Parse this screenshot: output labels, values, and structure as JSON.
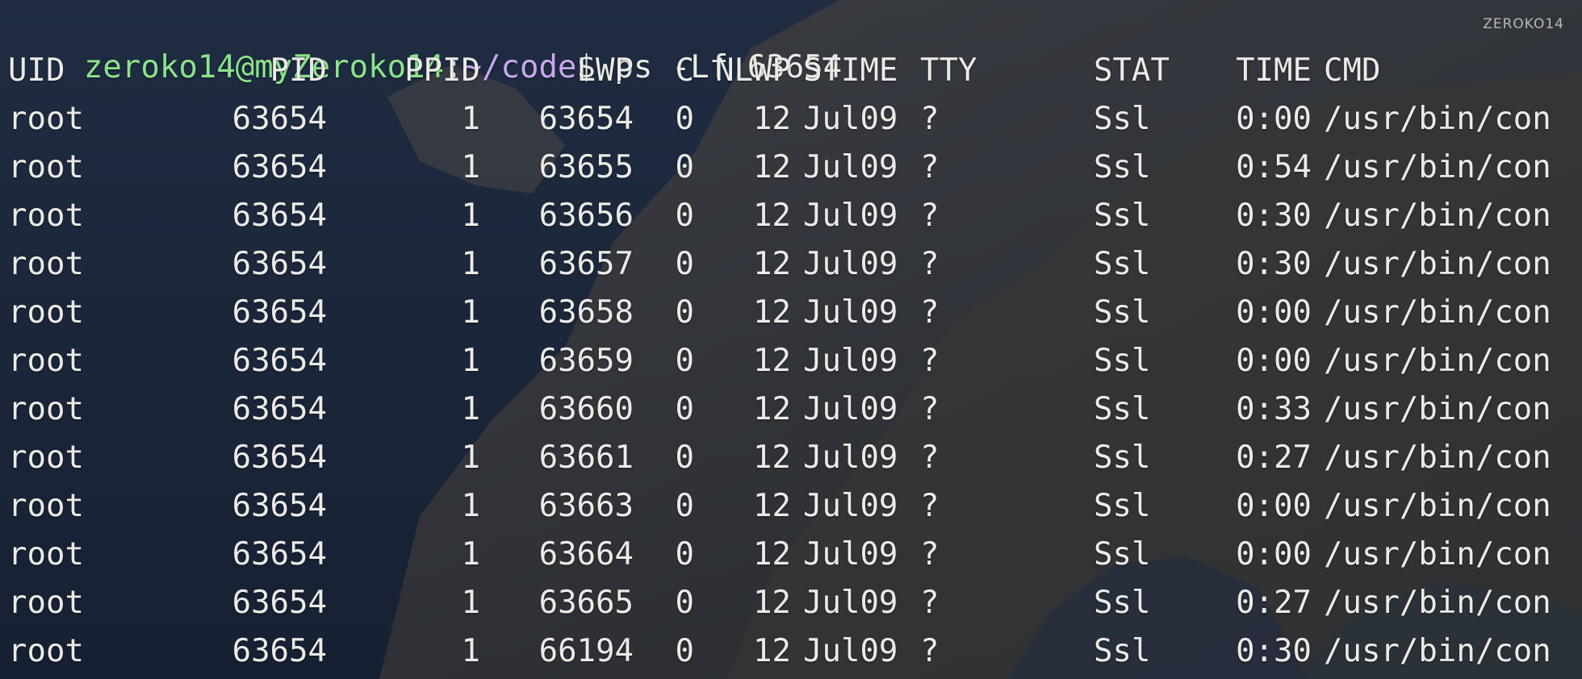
{
  "terminal": {
    "prompt": {
      "user_host": "zeroko14@myZeroko14",
      "separator": ":",
      "path": "~/code",
      "dollar": "$",
      "command": " ps -Lf 63654"
    },
    "columns": [
      "UID",
      "PID",
      "PPID",
      "LWP",
      "C",
      "NLWP",
      "STIME",
      "TTY",
      "STAT",
      "TIME",
      "CMD"
    ],
    "rows": [
      [
        "root",
        "63654",
        "1",
        "63654",
        "0",
        "12",
        "Jul09",
        "?",
        "Ssl",
        "0:00",
        "/usr/bin/con"
      ],
      [
        "root",
        "63654",
        "1",
        "63655",
        "0",
        "12",
        "Jul09",
        "?",
        "Ssl",
        "0:54",
        "/usr/bin/con"
      ],
      [
        "root",
        "63654",
        "1",
        "63656",
        "0",
        "12",
        "Jul09",
        "?",
        "Ssl",
        "0:30",
        "/usr/bin/con"
      ],
      [
        "root",
        "63654",
        "1",
        "63657",
        "0",
        "12",
        "Jul09",
        "?",
        "Ssl",
        "0:30",
        "/usr/bin/con"
      ],
      [
        "root",
        "63654",
        "1",
        "63658",
        "0",
        "12",
        "Jul09",
        "?",
        "Ssl",
        "0:00",
        "/usr/bin/con"
      ],
      [
        "root",
        "63654",
        "1",
        "63659",
        "0",
        "12",
        "Jul09",
        "?",
        "Ssl",
        "0:00",
        "/usr/bin/con"
      ],
      [
        "root",
        "63654",
        "1",
        "63660",
        "0",
        "12",
        "Jul09",
        "?",
        "Ssl",
        "0:33",
        "/usr/bin/con"
      ],
      [
        "root",
        "63654",
        "1",
        "63661",
        "0",
        "12",
        "Jul09",
        "?",
        "Ssl",
        "0:27",
        "/usr/bin/con"
      ],
      [
        "root",
        "63654",
        "1",
        "63663",
        "0",
        "12",
        "Jul09",
        "?",
        "Ssl",
        "0:00",
        "/usr/bin/con"
      ],
      [
        "root",
        "63654",
        "1",
        "63664",
        "0",
        "12",
        "Jul09",
        "?",
        "Ssl",
        "0:00",
        "/usr/bin/con"
      ],
      [
        "root",
        "63654",
        "1",
        "63665",
        "0",
        "12",
        "Jul09",
        "?",
        "Ssl",
        "0:27",
        "/usr/bin/con"
      ],
      [
        "root",
        "63654",
        "1",
        "66194",
        "0",
        "12",
        "Jul09",
        "?",
        "Ssl",
        "0:30",
        "/usr/bin/con"
      ]
    ]
  },
  "watermark": "ZEROKO14",
  "colors": {
    "prompt_user": "#8be38a",
    "prompt_path": "#c8a8f0",
    "text": "#ecebe7"
  }
}
